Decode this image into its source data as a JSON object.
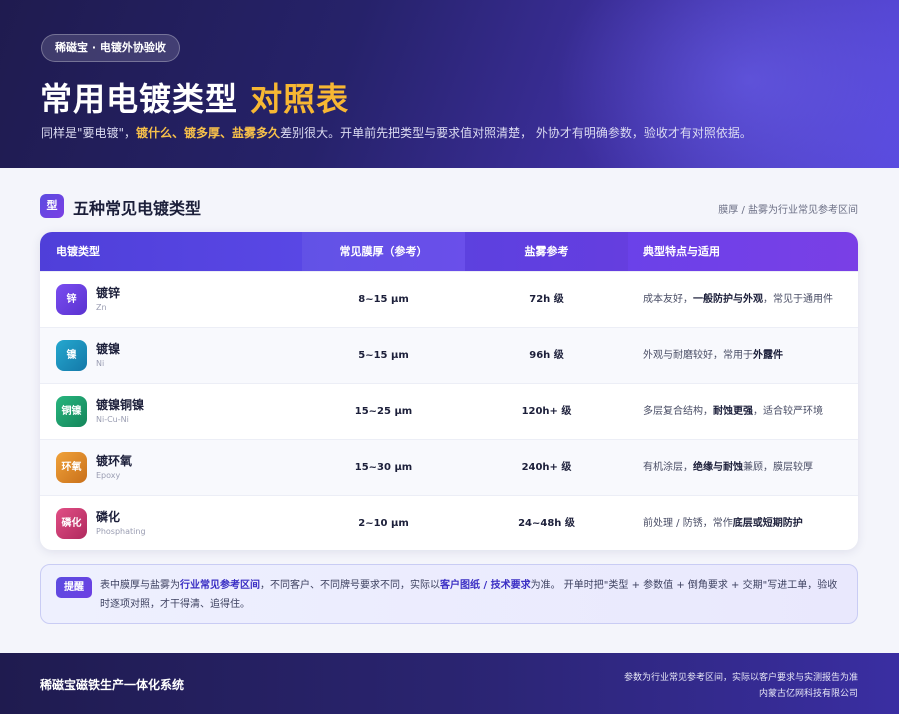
{
  "hero": {
    "pill": "稀磁宝 · 电镀外协验收",
    "title_main": "常用电镀类型",
    "title_accent": "对照表",
    "sub_1": "同样是\"要电镀\"，",
    "sub_hl": "镀什么、镀多厚、盐雾多久",
    "sub_2": "差别很大。开单前先把类型与要求值对照清楚， 外协才有明确参数，验收才有对照依据。"
  },
  "section": {
    "badge": "型",
    "title": "五种常见电镀类型",
    "note": "膜厚 / 盐雾为行业常见参考区间"
  },
  "table": {
    "headers": [
      "电镀类型",
      "常见膜厚（参考）",
      "盐雾参考",
      "典型特点与适用"
    ],
    "rows": [
      {
        "badge": "锌",
        "name": "镀锌",
        "code": "Zn",
        "thickness": "8~15 μm",
        "salt": "72h 级",
        "desc_1": "成本友好，",
        "desc_b": "一般防护与外观",
        "desc_2": "，常见于通用件",
        "color": "#6a3fe0"
      },
      {
        "badge": "镍",
        "name": "镀镍",
        "code": "Ni",
        "thickness": "5~15 μm",
        "salt": "96h 级",
        "desc_1": "外观与耐磨较好，常用于",
        "desc_b": "外露件",
        "desc_2": "",
        "color": "#1a8fb8"
      },
      {
        "badge": "铜镍",
        "name": "镀镍铜镍",
        "code": "Ni-Cu-Ni",
        "thickness": "15~25 μm",
        "salt": "120h+ 级",
        "desc_1": "多层复合结构，",
        "desc_b": "耐蚀更强",
        "desc_2": "，适合较严环境",
        "color": "#1a9a6a"
      },
      {
        "badge": "环氧",
        "name": "镀环氧",
        "code": "Epoxy",
        "thickness": "15~30 μm",
        "salt": "240h+ 级",
        "desc_1": "有机涂层，",
        "desc_b": "绝缘与耐蚀",
        "desc_2": "兼顾，膜层较厚",
        "color": "#d9821a"
      },
      {
        "badge": "磷化",
        "name": "磷化",
        "code": "Phosphating",
        "thickness": "2~10 μm",
        "salt": "24~48h 级",
        "desc_1": "前处理 / 防锈，常作",
        "desc_b": "底层或短期防护",
        "desc_2": "",
        "color": "#c8336a"
      }
    ]
  },
  "notice": {
    "tag": "提醒",
    "t1": "表中膜厚与盐雾为",
    "b1": "行业常见参考区间",
    "t2": "，不同客户、不同牌号要求不同，实际以",
    "b2": "客户图纸 / 技术要求",
    "t3": "为准。 开单时把\"类型 + 参数值 + 倒角要求 + 交期\"写进工单，验收时逐项对照，才干得清、追得住。"
  },
  "footer": {
    "left": "稀磁宝磁铁生产一体化系统",
    "right_1": "参数为行业常见参考区间，实际以客户要求与实测报告为准",
    "right_2": "内蒙古亿网科技有限公司"
  }
}
